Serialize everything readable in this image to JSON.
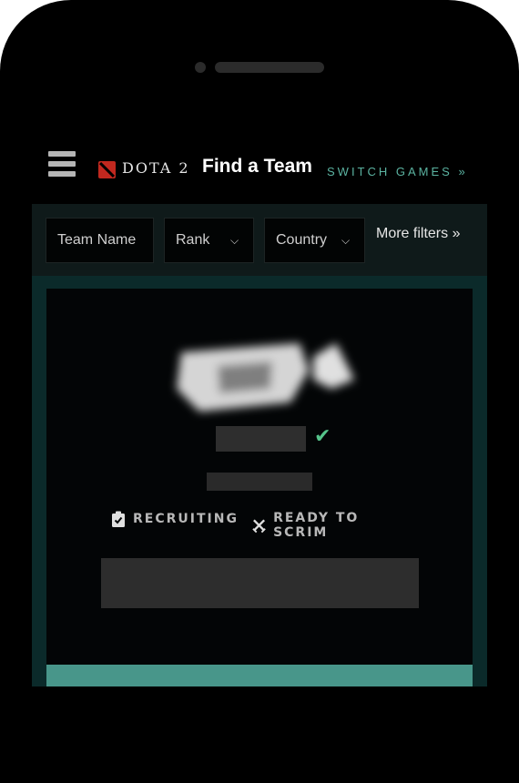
{
  "header": {
    "brand": "DOTA 2",
    "title": "Find a Team",
    "switch_games": "SWITCH GAMES »"
  },
  "filters": {
    "team_name": "Team Name",
    "rank": "Rank",
    "country": "Country",
    "more_filters": "More filters »"
  },
  "card": {
    "tags": [
      "RECRUITING",
      "READY TO SCRIM"
    ]
  },
  "colors": {
    "accent": "#5bb3a1",
    "verified": "#55c48a",
    "teal_bar": "#48968a",
    "brand_red": "#c1281f"
  }
}
